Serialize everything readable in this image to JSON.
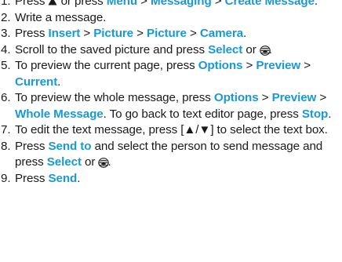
{
  "steps": [
    {
      "num": "1.",
      "parts": [
        {
          "t": "text",
          "v": "Press "
        },
        {
          "t": "icon",
          "icon": "up-arrow-key-icon"
        },
        {
          "t": "text",
          "v": " or press "
        },
        {
          "t": "hl",
          "v": "Menu"
        },
        {
          "t": "text",
          "v": " > "
        },
        {
          "t": "hl",
          "v": "Messaging"
        },
        {
          "t": "text",
          "v": " > "
        },
        {
          "t": "hl",
          "v": "Create Message"
        },
        {
          "t": "text",
          "v": "."
        }
      ]
    },
    {
      "num": "2.",
      "parts": [
        {
          "t": "text",
          "v": "Write a message."
        }
      ]
    },
    {
      "num": "3.",
      "parts": [
        {
          "t": "text",
          "v": "Press "
        },
        {
          "t": "hl",
          "v": "Insert"
        },
        {
          "t": "text",
          "v": " > "
        },
        {
          "t": "hl",
          "v": "Picture"
        },
        {
          "t": "text",
          "v": " > "
        },
        {
          "t": "hl",
          "v": "Picture"
        },
        {
          "t": "text",
          "v": " > "
        },
        {
          "t": "hl",
          "v": "Camera"
        },
        {
          "t": "text",
          "v": "."
        }
      ]
    },
    {
      "num": "4.",
      "parts": [
        {
          "t": "text",
          "v": "Scroll to the saved picture and press "
        },
        {
          "t": "hl",
          "v": "Select"
        },
        {
          "t": "text",
          "v": " or "
        },
        {
          "t": "icon",
          "icon": "center-select-key-icon"
        },
        {
          "t": "text",
          "v": "."
        }
      ]
    },
    {
      "num": "5.",
      "parts": [
        {
          "t": "text",
          "v": "To preview the current page, press "
        },
        {
          "t": "hl",
          "v": "Options"
        },
        {
          "t": "text",
          "v": " > "
        },
        {
          "t": "hl",
          "v": "Preview"
        },
        {
          "t": "text",
          "v": " > "
        },
        {
          "t": "hl",
          "v": "Current"
        },
        {
          "t": "text",
          "v": "."
        }
      ]
    },
    {
      "num": "6.",
      "parts": [
        {
          "t": "text",
          "v": "To preview the whole message, press "
        },
        {
          "t": "hl",
          "v": "Options"
        },
        {
          "t": "text",
          "v": " > "
        },
        {
          "t": "hl",
          "v": "Preview"
        },
        {
          "t": "text",
          "v": " > "
        },
        {
          "t": "hl",
          "v": "Whole Message"
        },
        {
          "t": "text",
          "v": ". To go back to text editor page, press "
        },
        {
          "t": "hl",
          "v": "Stop"
        },
        {
          "t": "text",
          "v": "."
        }
      ]
    },
    {
      "num": "7.",
      "parts": [
        {
          "t": "text",
          "v": "To edit the text message, press [▲/▼] to select the text box."
        }
      ]
    },
    {
      "num": "8.",
      "parts": [
        {
          "t": "text",
          "v": "Press "
        },
        {
          "t": "hl",
          "v": "Send to"
        },
        {
          "t": "text",
          "v": " and select the person to send message and press "
        },
        {
          "t": "hl",
          "v": "Select"
        },
        {
          "t": "text",
          "v": " or "
        },
        {
          "t": "icon",
          "icon": "center-select-key-icon"
        },
        {
          "t": "text",
          "v": "."
        }
      ]
    },
    {
      "num": "9.",
      "parts": [
        {
          "t": "text",
          "v": "Press "
        },
        {
          "t": "hl",
          "v": "Send"
        },
        {
          "t": "text",
          "v": "."
        }
      ]
    }
  ],
  "colors": {
    "highlight": "#1a98d5",
    "text": "#1a1a1a"
  }
}
